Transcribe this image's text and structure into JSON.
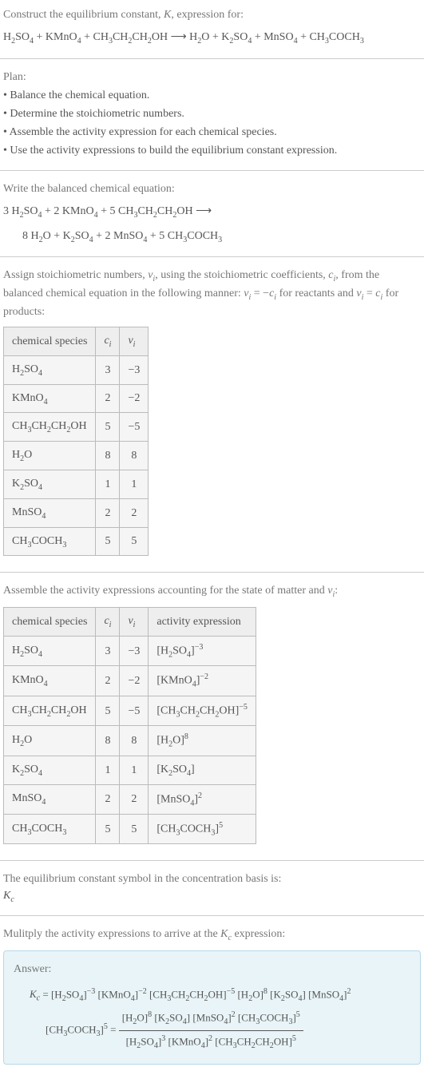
{
  "title": "Construct the equilibrium constant, K, expression for:",
  "main_equation": "H₂SO₄ + KMnO₄ + CH₃CH₂CH₂OH ⟶ H₂O + K₂SO₄ + MnSO₄ + CH₃COCH₃",
  "plan": {
    "header": "Plan:",
    "items": [
      "• Balance the chemical equation.",
      "• Determine the stoichiometric numbers.",
      "• Assemble the activity expression for each chemical species.",
      "• Use the activity expressions to build the equilibrium constant expression."
    ]
  },
  "balanced": {
    "header": "Write the balanced chemical equation:",
    "line1": "3 H₂SO₄ + 2 KMnO₄ + 5 CH₃CH₂CH₂OH ⟶",
    "line2": "8 H₂O + K₂SO₄ + 2 MnSO₄ + 5 CH₃COCH₃"
  },
  "stoich_intro": "Assign stoichiometric numbers, νᵢ, using the stoichiometric coefficients, cᵢ, from the balanced chemical equation in the following manner: νᵢ = −cᵢ for reactants and νᵢ = cᵢ for products:",
  "table1": {
    "headers": [
      "chemical species",
      "cᵢ",
      "νᵢ"
    ],
    "rows": [
      [
        "H₂SO₄",
        "3",
        "−3"
      ],
      [
        "KMnO₄",
        "2",
        "−2"
      ],
      [
        "CH₃CH₂CH₂OH",
        "5",
        "−5"
      ],
      [
        "H₂O",
        "8",
        "8"
      ],
      [
        "K₂SO₄",
        "1",
        "1"
      ],
      [
        "MnSO₄",
        "2",
        "2"
      ],
      [
        "CH₃COCH₃",
        "5",
        "5"
      ]
    ]
  },
  "activity_intro": "Assemble the activity expressions accounting for the state of matter and νᵢ:",
  "table2": {
    "headers": [
      "chemical species",
      "cᵢ",
      "νᵢ",
      "activity expression"
    ],
    "rows": [
      [
        "H₂SO₄",
        "3",
        "−3",
        "[H₂SO₄]⁻³"
      ],
      [
        "KMnO₄",
        "2",
        "−2",
        "[KMnO₄]⁻²"
      ],
      [
        "CH₃CH₂CH₂OH",
        "5",
        "−5",
        "[CH₃CH₂CH₂OH]⁻⁵"
      ],
      [
        "H₂O",
        "8",
        "8",
        "[H₂O]⁸"
      ],
      [
        "K₂SO₄",
        "1",
        "1",
        "[K₂SO₄]"
      ],
      [
        "MnSO₄",
        "2",
        "2",
        "[MnSO₄]²"
      ],
      [
        "CH₃COCH₃",
        "5",
        "5",
        "[CH₃COCH₃]⁵"
      ]
    ]
  },
  "kc_symbol": {
    "line1": "The equilibrium constant symbol in the concentration basis is:",
    "line2": "K_c"
  },
  "multiply_header": "Mulitply the activity expressions to arrive at the K_c expression:",
  "answer": {
    "label": "Answer:",
    "expr_line1": "K_c = [H₂SO₄]⁻³ [KMnO₄]⁻² [CH₃CH₂CH₂OH]⁻⁵ [H₂O]⁸ [K₂SO₄] [MnSO₄]²",
    "expr_line2_prefix": "[CH₃COCH₃]⁵ = ",
    "frac_num": "[H₂O]⁸ [K₂SO₄] [MnSO₄]² [CH₃COCH₃]⁵",
    "frac_den": "[H₂SO₄]³ [KMnO₄]² [CH₃CH₂CH₂OH]⁵"
  }
}
